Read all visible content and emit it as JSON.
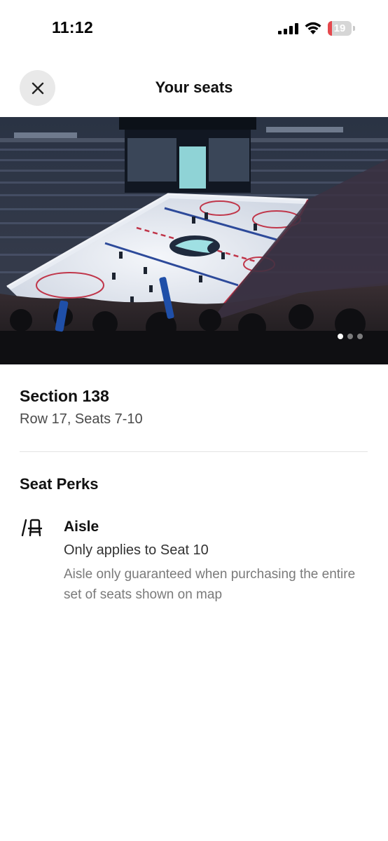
{
  "status_bar": {
    "time": "11:12",
    "battery_level": "19",
    "battery_color": "#e5484d"
  },
  "header": {
    "title": "Your seats",
    "close_icon": "close-icon"
  },
  "hero": {
    "image_name": "arena-seat-view-image",
    "carousel_total": 3,
    "carousel_active": 1
  },
  "seat": {
    "section": "Section 138",
    "details": "Row 17, Seats 7-10"
  },
  "perks": {
    "title": "Seat Perks",
    "items": [
      {
        "icon": "aisle-seat-icon",
        "name": "Aisle",
        "detail": "Only applies to Seat 10",
        "note": "Aisle only guaranteed when purchasing the entire set of seats shown on map"
      }
    ]
  }
}
